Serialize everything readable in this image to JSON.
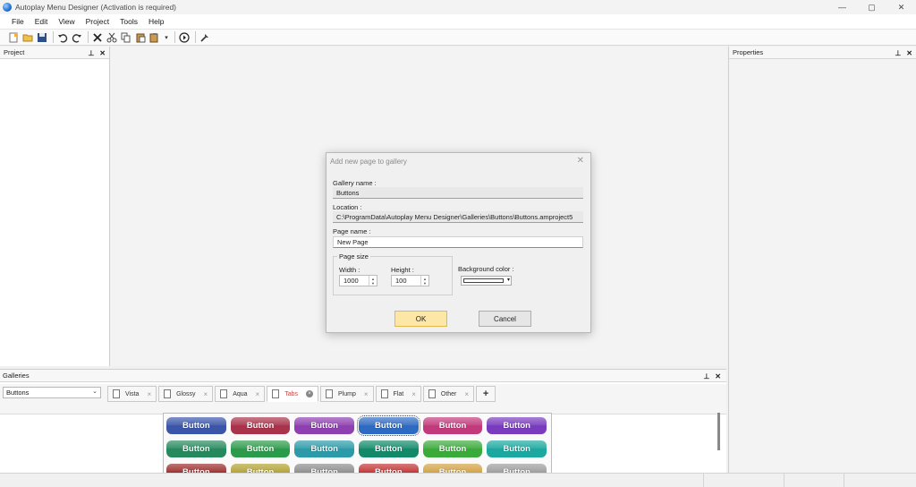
{
  "app": {
    "title": "Autoplay Menu Designer (Activation is required)"
  },
  "window_controls": {
    "minimize": "—",
    "maximize": "▢",
    "close": "✕"
  },
  "menu": [
    "File",
    "Edit",
    "View",
    "Project",
    "Tools",
    "Help"
  ],
  "toolbar_icons": [
    "new-project-icon",
    "open-folder-icon",
    "save-icon",
    "undo-icon",
    "redo-icon",
    "delete-icon",
    "cut-icon",
    "copy-icon",
    "paste-icon",
    "paste-special-icon",
    "dropdown-arrow-icon",
    "preview-play-icon",
    "build-tools-icon"
  ],
  "panels": {
    "project": {
      "title": "Project",
      "pin": "⊥",
      "close": "✕"
    },
    "properties": {
      "title": "Properties",
      "pin": "⊥",
      "close": "✕"
    },
    "galleries": {
      "title": "Galleries",
      "pin": "⊥",
      "close": "✕"
    }
  },
  "galleries": {
    "selected_gallery": "Buttons",
    "tabs": [
      {
        "label": "Vista",
        "active": false
      },
      {
        "label": "Glossy",
        "active": false
      },
      {
        "label": "Aqua",
        "active": false
      },
      {
        "label": "Tabs",
        "active": true
      },
      {
        "label": "Plump",
        "active": false
      },
      {
        "label": "Flat",
        "active": false
      },
      {
        "label": "Other",
        "active": false
      }
    ],
    "add_tab": "+",
    "button_label": "Button",
    "button_colors": [
      [
        "#3b56a8",
        "#a8334a",
        "#8e3fb0",
        "#2e6ac2",
        "#c23a7c",
        "#7a3cbf"
      ],
      [
        "#26895e",
        "#2b9a4a",
        "#2c9aa8",
        "#128a6a",
        "#3aaa3a",
        "#1aa8a0"
      ],
      [
        "#9a2a2a",
        "#b0a030",
        "#8a8a8a",
        "#c03030",
        "#d0a040",
        "#9a9a9a"
      ]
    ]
  },
  "dialog": {
    "title": "Add new page to gallery",
    "close": "✕",
    "gallery_name_label": "Gallery name :",
    "gallery_name": "Buttons",
    "location_label": "Location :",
    "location": "C:\\ProgramData\\Autoplay Menu Designer\\Galleries\\Buttons\\Buttons.amproject5",
    "page_name_label": "Page name :",
    "page_name": "New Page",
    "page_size_label": "Page size",
    "width_label": "Width :",
    "width": "1000",
    "height_label": "Height :",
    "height": "100",
    "background_color_label": "Background color :",
    "background_color": "#ffffff",
    "ok": "OK",
    "cancel": "Cancel"
  }
}
